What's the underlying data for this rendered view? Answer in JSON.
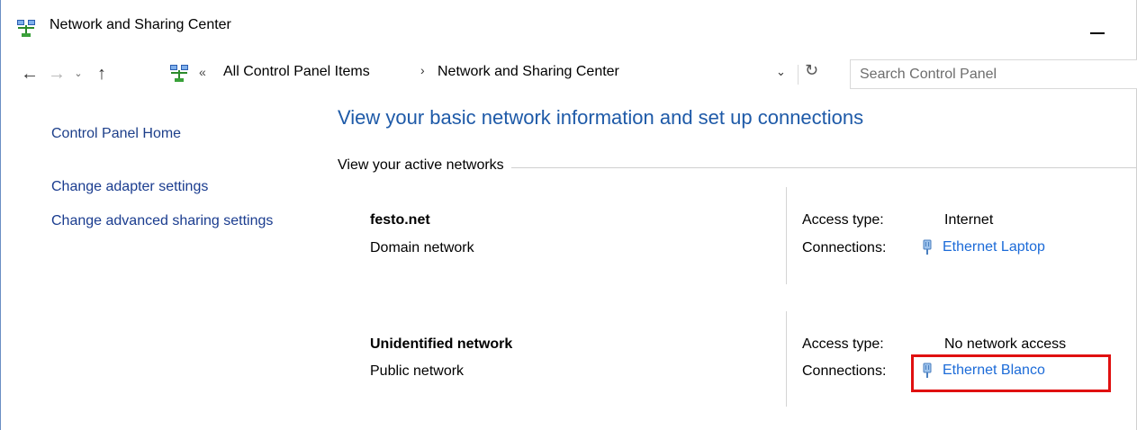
{
  "window": {
    "title": "Network and Sharing Center",
    "icon": "network-sharing-icon",
    "minimize_icon": "minimize-icon"
  },
  "nav": {
    "back_icon": "back-arrow-icon",
    "forward_icon": "forward-arrow-icon",
    "recent_icon": "chevron-down-icon",
    "up_icon": "up-arrow-icon",
    "back_glyph": "←",
    "forward_glyph": "→",
    "recent_glyph": "⌄",
    "up_glyph": "↑"
  },
  "address": {
    "chevrons": "«",
    "crumbs": [
      "All Control Panel Items",
      "Network and Sharing Center"
    ],
    "separator": "›",
    "dropdown_glyph": "⌄",
    "refresh_glyph": "↻"
  },
  "search": {
    "placeholder": "Search Control Panel"
  },
  "sidebar": {
    "items": [
      {
        "label": "Control Panel Home"
      },
      {
        "label": "Change adapter settings"
      },
      {
        "label": "Change advanced sharing settings"
      }
    ]
  },
  "main": {
    "heading": "View your basic network information and set up connections",
    "section_label": "View your active networks",
    "networks": [
      {
        "name": "festo.net",
        "type": "Domain network",
        "access_type_label": "Access type:",
        "access_type": "Internet",
        "connections_label": "Connections:",
        "connection": "Ethernet Laptop"
      },
      {
        "name": "Unidentified network",
        "type": "Public network",
        "access_type_label": "Access type:",
        "access_type": "No network access",
        "connections_label": "Connections:",
        "connection": "Ethernet Blanco",
        "highlighted": true
      }
    ]
  },
  "colors": {
    "heading": "#1e5aa8",
    "link": "#1c6bd8",
    "highlight": "#e01010"
  }
}
